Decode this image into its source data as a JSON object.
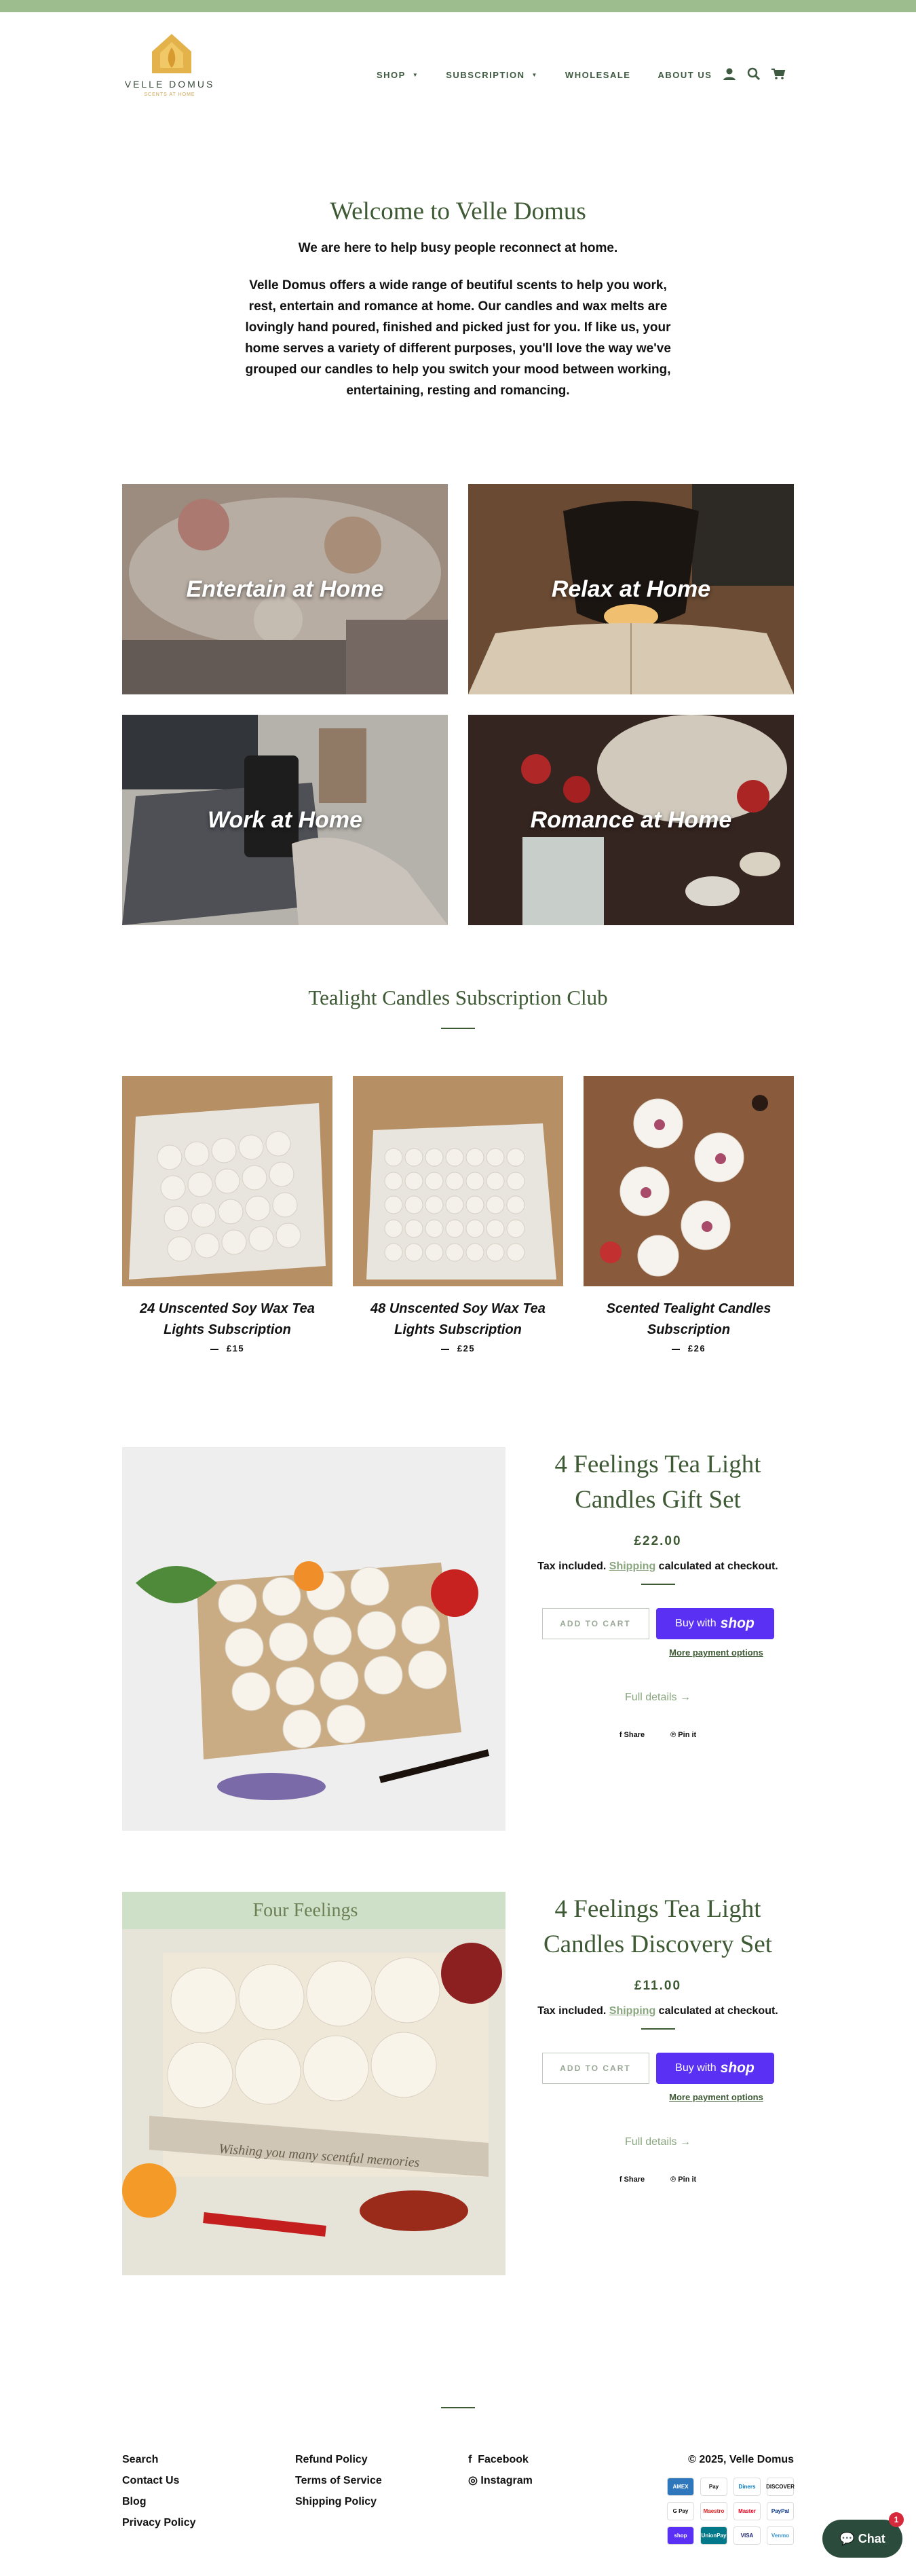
{
  "brand": {
    "name": "VELLE DOMUS",
    "tagline": "SCENTS AT HOME",
    "color_primary": "#3e5a34",
    "color_topbar": "#9ebd8e",
    "color_logo": "#e3b24a"
  },
  "nav": {
    "items": [
      {
        "label": "SHOP",
        "has_dropdown": true
      },
      {
        "label": "SUBSCRIPTION",
        "has_dropdown": true
      },
      {
        "label": "WHOLESALE",
        "has_dropdown": false
      },
      {
        "label": "ABOUT US",
        "has_dropdown": false
      }
    ],
    "icons": [
      "account-icon",
      "search-icon",
      "cart-icon"
    ]
  },
  "welcome": {
    "title": "Welcome to Velle Domus",
    "lead": "We are here to help busy people reconnect at home.",
    "body": "Velle Domus offers a wide range of beutiful scents to help you work, rest, entertain and romance at home. Our candles and wax melts are lovingly hand poured, finished and picked just for you. If like us, your home serves a variety of different purposes, you'll love the way we've grouped our candles to help you switch your mood between working, entertaining, resting and romancing."
  },
  "collections": [
    {
      "label": "Entertain at Home"
    },
    {
      "label": "Relax at Home"
    },
    {
      "label": "Work at Home"
    },
    {
      "label": "Romance at Home"
    }
  ],
  "subscription": {
    "title": "Tealight Candles Subscription Club",
    "products": [
      {
        "name": "24 Unscented Soy Wax Tea Lights Subscription",
        "price": "£15"
      },
      {
        "name": "48 Unscented Soy Wax Tea Lights Subscription",
        "price": "£25"
      },
      {
        "name": "Scented Tealight Candles Subscription",
        "price": "£26"
      }
    ]
  },
  "featured": [
    {
      "title": "4 Feelings Tea Light Candles Gift Set",
      "price": "£22.00",
      "tax_pre": "Tax included.",
      "tax_link": "Shipping",
      "tax_post": "calculated at checkout.",
      "add_to_cart": "ADD TO CART",
      "buy_with": "Buy with",
      "shop": "shop",
      "more_options": "More payment options",
      "full_details": "Full details →",
      "share": "Share",
      "pin": "Pin it"
    },
    {
      "title": "4 Feelings Tea Light Candles Discovery Set",
      "price": "£11.00",
      "tax_pre": "Tax included.",
      "tax_link": "Shipping",
      "tax_post": "calculated at checkout.",
      "add_to_cart": "ADD TO CART",
      "buy_with": "Buy with",
      "shop": "shop",
      "more_options": "More payment options",
      "full_details": "Full details →",
      "share": "Share",
      "pin": "Pin it",
      "image_text_top": "Four Feelings",
      "image_text_bottom": "Wishing you many scentful memories"
    }
  ],
  "footer": {
    "col1": [
      "Search",
      "Contact Us",
      "Blog",
      "Privacy Policy"
    ],
    "col2": [
      "Refund Policy",
      "Terms of Service",
      "Shipping Policy"
    ],
    "social": [
      "Facebook",
      "Instagram"
    ],
    "copyright": "© 2025, Velle Domus",
    "payments": [
      "AMEX",
      "Pay",
      "Diners",
      "DISCOVER",
      "G Pay",
      "Maestro",
      "Master",
      "PayPal",
      "shop",
      "UnionPay",
      "VISA",
      "Venmo"
    ]
  },
  "chat": {
    "label": "Chat",
    "badge": "1"
  }
}
